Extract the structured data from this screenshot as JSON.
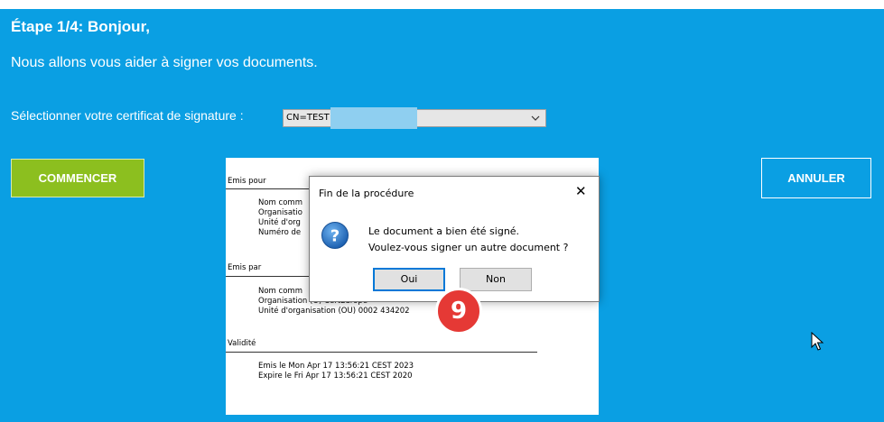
{
  "header": {
    "step_title": "Étape 1/4: Bonjour,",
    "subtitle": "Nous allons vous aider à signer vos documents."
  },
  "certificate": {
    "label": "Sélectionner votre certificat de signature :",
    "selected_value": "CN=TEST"
  },
  "buttons": {
    "start": "COMMENCER",
    "cancel": "ANNULER"
  },
  "cert_details": {
    "issued_to_header": "Emis pour",
    "issued_to_fields": [
      "Nom comm",
      "Organisatio",
      "Unité d'org",
      "Numéro de"
    ],
    "issued_by_header": "Emis par",
    "issued_by_fields": [
      "Nom comm",
      "Organisation (O) CertEurope",
      "Unité d'organisation (OU) 0002 434202"
    ],
    "validity_header": "Validité",
    "validity_fields": [
      "Emis le Mon Apr 17 13:56:21 CEST 2023",
      "Expire le Fri Apr 17 13:56:21 CEST 2020"
    ]
  },
  "dialog": {
    "title": "Fin de la procédure",
    "close_glyph": "✕",
    "message_line1": "Le document a bien été signé.",
    "message_line2": "Voulez-vous signer un autre document ?",
    "yes_label": "Oui",
    "no_label": "Non"
  },
  "annotation": {
    "step_number": "9"
  },
  "colors": {
    "background": "#0a9fe3",
    "start_button": "#8cbf1f",
    "badge": "#e53935",
    "dialog_focus": "#0078d7"
  },
  "icons": {
    "dialog_icon": "question-icon",
    "select_arrow": "chevron-down-icon",
    "pointer": "mouse-cursor-icon"
  }
}
